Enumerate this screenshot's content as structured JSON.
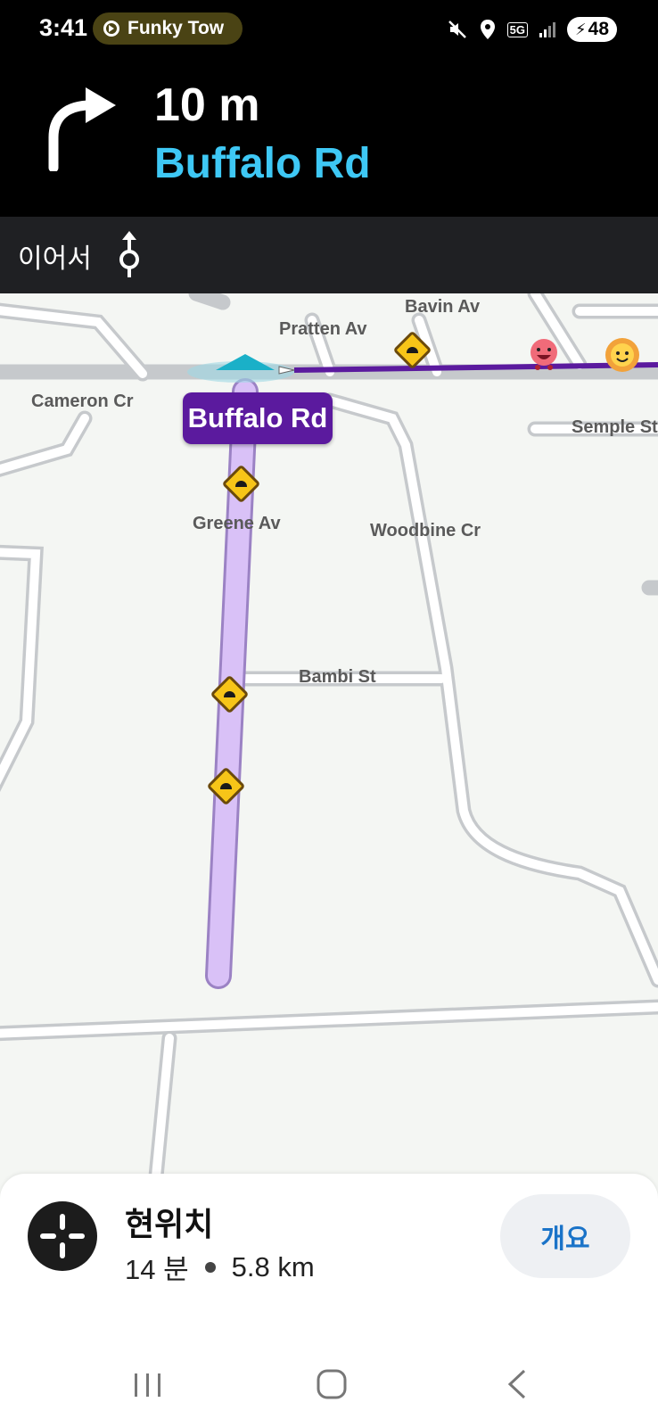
{
  "status_bar": {
    "time": "3:41",
    "media_pill": "Funky Tow",
    "network": "5G",
    "battery": "48"
  },
  "navigation": {
    "distance": "10 m",
    "street": "Buffalo Rd",
    "next_label": "이어서",
    "turn_icon": "turn-right-arrow",
    "next_icon": "roundabout-continue"
  },
  "map": {
    "current_street_callout": "Buffalo Rd",
    "street_labels": [
      "Pratten Av",
      "Bavin Av",
      "Cameron Cr",
      "Semple St",
      "Greene Av",
      "Woodbine Cr",
      "Bambi St"
    ],
    "route_color": "#5b1a9e",
    "route_ahead_color": "#d9c1f7"
  },
  "bottom_sheet": {
    "destination": "현위치",
    "eta_time": "14 분",
    "eta_distance": "5.8 km",
    "overview_button": "개요"
  },
  "colors": {
    "street_highlight": "#3ec8f5",
    "speed_bump_sign": "#f7c518"
  }
}
